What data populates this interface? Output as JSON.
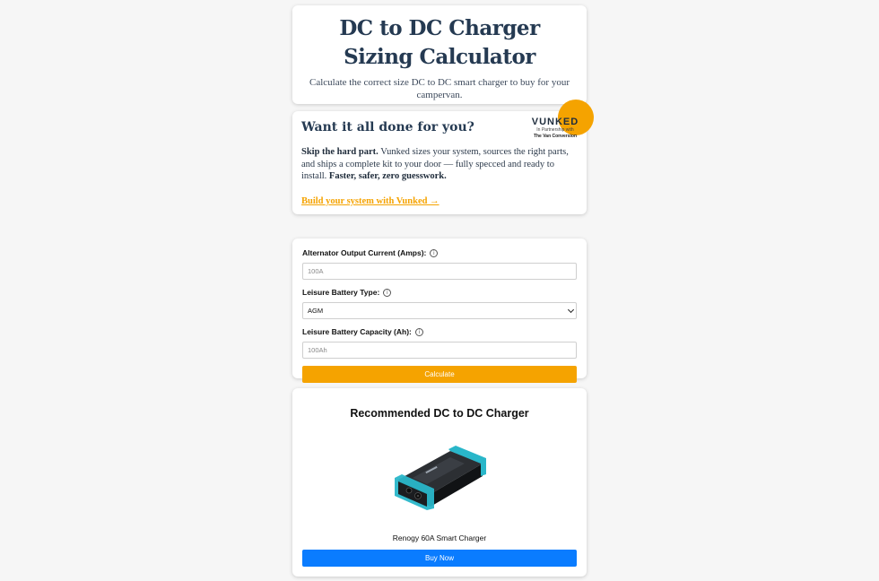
{
  "header": {
    "title": "DC to DC Charger Sizing Calculator",
    "subtitle": "Calculate the correct size DC to DC smart charger to buy for your campervan."
  },
  "promo": {
    "title": "Want it all done for you?",
    "brand_name": "VUNKED",
    "brand_partner": "In Partnership with",
    "brand_company": "The Van Conversion",
    "body_lead": "Skip the hard part.",
    "body_main": " Vunked sizes your system, sources the right parts, and ships a complete kit to your door — fully specced and ready to install. ",
    "body_emphasis": "Faster, safer, zero guesswork.",
    "link_label": "Build your system with Vunked →",
    "accent_color": "#f5a300"
  },
  "form": {
    "alternator_label": "Alternator Output Current (Amps):",
    "alternator_placeholder": "100A",
    "battery_type_label": "Leisure Battery Type:",
    "battery_type_value": "AGM",
    "capacity_label": "Leisure Battery Capacity (Ah):",
    "capacity_placeholder": "100Ah",
    "info_icon": "i",
    "calculate_label": "Calculate",
    "calculate_color": "#f5a300"
  },
  "result": {
    "title": "Recommended DC to DC Charger",
    "product_name": "Renogy 60A Smart Charger",
    "buy_label": "Buy Now",
    "buy_color": "#0a7cff"
  }
}
